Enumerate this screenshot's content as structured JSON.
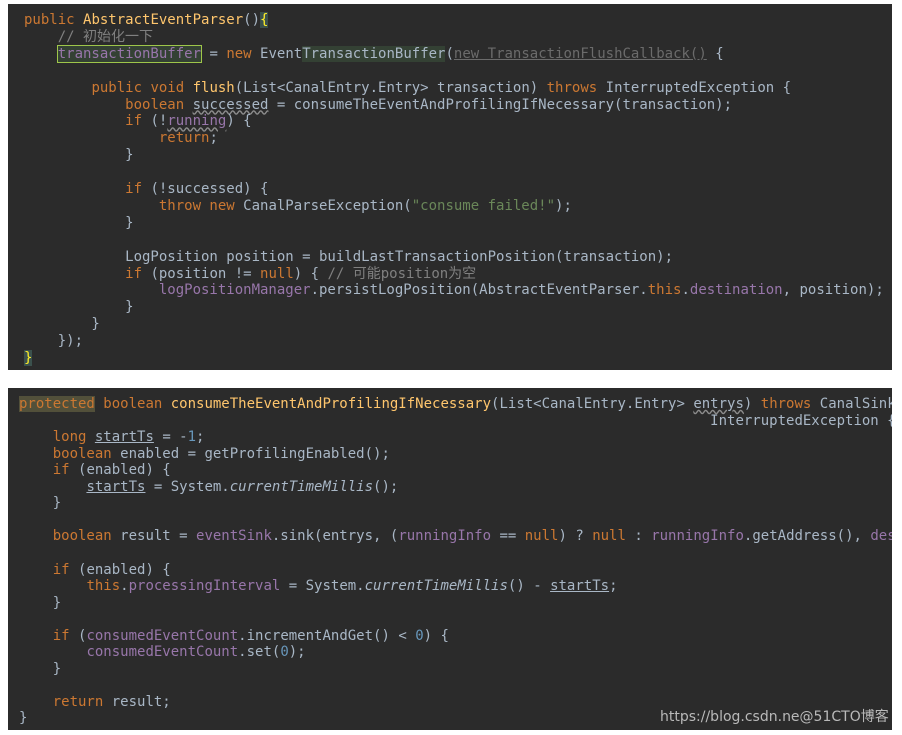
{
  "snippet1": {
    "lines": [
      [
        {
          "t": "public ",
          "c": "kw"
        },
        {
          "t": "AbstractEventParser",
          "c": "fn"
        },
        {
          "t": "()"
        },
        {
          "t": "{",
          "c": "brace-hl"
        }
      ],
      [
        {
          "t": "    "
        },
        {
          "t": "// 初始化一下",
          "c": "cm"
        }
      ],
      [
        {
          "t": "    "
        },
        {
          "t": "transactionBuffer",
          "c": "hl-box"
        },
        {
          "t": " = "
        },
        {
          "t": "new ",
          "c": "kw"
        },
        {
          "t": "Event"
        },
        {
          "t": "TransactionBuffer",
          "c": "hl-green"
        },
        {
          "t": "("
        },
        {
          "t": "new TransactionFlushCallback()",
          "c": "strike-dim"
        },
        {
          "t": " {"
        }
      ],
      [],
      [
        {
          "t": "        "
        },
        {
          "t": "public void ",
          "c": "kw"
        },
        {
          "t": "flush",
          "c": "fn"
        },
        {
          "t": "(List<CanalEntry.Entry> transaction) "
        },
        {
          "t": "throws ",
          "c": "kw"
        },
        {
          "t": "InterruptedException {"
        }
      ],
      [
        {
          "t": "            "
        },
        {
          "t": "boolean ",
          "c": "kw"
        },
        {
          "t": "successed",
          "c": "wavy"
        },
        {
          "t": " = consumeTheEventAndProfilingIfNecessary(transaction);"
        }
      ],
      [
        {
          "t": "            "
        },
        {
          "t": "if ",
          "c": "kw"
        },
        {
          "t": "(!"
        },
        {
          "t": "running",
          "c": "fld wavy"
        },
        {
          "t": ") {"
        }
      ],
      [
        {
          "t": "                "
        },
        {
          "t": "return",
          "c": "kw"
        },
        {
          "t": ";"
        }
      ],
      [
        {
          "t": "            }"
        }
      ],
      [],
      [
        {
          "t": "            "
        },
        {
          "t": "if ",
          "c": "kw"
        },
        {
          "t": "(!successed) {"
        }
      ],
      [
        {
          "t": "                "
        },
        {
          "t": "throw new ",
          "c": "kw"
        },
        {
          "t": "CanalParseException("
        },
        {
          "t": "\"consume failed!\"",
          "c": "str"
        },
        {
          "t": ");"
        }
      ],
      [
        {
          "t": "            }"
        }
      ],
      [],
      [
        {
          "t": "            LogPosition position = buildLastTransactionPosition(transaction);"
        }
      ],
      [
        {
          "t": "            "
        },
        {
          "t": "if ",
          "c": "kw"
        },
        {
          "t": "(position != "
        },
        {
          "t": "null",
          "c": "kw"
        },
        {
          "t": ") { "
        },
        {
          "t": "// 可能position为空",
          "c": "cm"
        }
      ],
      [
        {
          "t": "                "
        },
        {
          "t": "logPositionManager",
          "c": "fld"
        },
        {
          "t": ".persistLogPosition(AbstractEventParser."
        },
        {
          "t": "this",
          "c": "kw"
        },
        {
          "t": "."
        },
        {
          "t": "destination",
          "c": "fld"
        },
        {
          "t": ", position);"
        }
      ],
      [
        {
          "t": "            }"
        }
      ],
      [
        {
          "t": "        }"
        }
      ],
      [
        {
          "t": "    });"
        }
      ],
      [
        {
          "t": "}",
          "c": "brace-hl"
        }
      ]
    ]
  },
  "snippet2": {
    "lines": [
      [
        {
          "t": "protected",
          "c": "prot-hl"
        },
        {
          "t": " "
        },
        {
          "t": "boolean ",
          "c": "kw"
        },
        {
          "t": "consumeTheEventAndProfilingIfNecessary",
          "c": "fn"
        },
        {
          "t": "(List<CanalEntry.Entry> "
        },
        {
          "t": "entrys",
          "c": "wavy"
        },
        {
          "t": ") "
        },
        {
          "t": "throws ",
          "c": "kw"
        },
        {
          "t": "CanalSinkException,"
        }
      ],
      [
        {
          "t": "                                                                                  InterruptedException {"
        }
      ],
      [
        {
          "t": "    "
        },
        {
          "t": "long ",
          "c": "kw"
        },
        {
          "t": "startTs",
          "c": "und"
        },
        {
          "t": " = -"
        },
        {
          "t": "1",
          "c": "num"
        },
        {
          "t": ";"
        }
      ],
      [
        {
          "t": "    "
        },
        {
          "t": "boolean ",
          "c": "kw"
        },
        {
          "t": "enabled = getProfilingEnabled();"
        }
      ],
      [
        {
          "t": "    "
        },
        {
          "t": "if ",
          "c": "kw"
        },
        {
          "t": "(enabled) {"
        }
      ],
      [
        {
          "t": "        "
        },
        {
          "t": "startTs",
          "c": "und"
        },
        {
          "t": " = System."
        },
        {
          "t": "currentTimeMillis",
          "c": "it"
        },
        {
          "t": "();"
        }
      ],
      [
        {
          "t": "    }"
        }
      ],
      [],
      [
        {
          "t": "    "
        },
        {
          "t": "boolean ",
          "c": "kw"
        },
        {
          "t": "result = "
        },
        {
          "t": "eventSink",
          "c": "fld"
        },
        {
          "t": ".sink(entrys, ("
        },
        {
          "t": "runningInfo",
          "c": "fld"
        },
        {
          "t": " == "
        },
        {
          "t": "null",
          "c": "kw"
        },
        {
          "t": ") ? "
        },
        {
          "t": "null ",
          "c": "kw"
        },
        {
          "t": ": "
        },
        {
          "t": "runningInfo",
          "c": "fld"
        },
        {
          "t": ".getAddress(), "
        },
        {
          "t": "destination",
          "c": "fld"
        },
        {
          "t": ");"
        }
      ],
      [],
      [
        {
          "t": "    "
        },
        {
          "t": "if ",
          "c": "kw"
        },
        {
          "t": "(enabled) {"
        }
      ],
      [
        {
          "t": "        "
        },
        {
          "t": "this",
          "c": "kw"
        },
        {
          "t": "."
        },
        {
          "t": "processingInterval",
          "c": "fld"
        },
        {
          "t": " = System."
        },
        {
          "t": "currentTimeMillis",
          "c": "it"
        },
        {
          "t": "() - "
        },
        {
          "t": "startTs",
          "c": "und"
        },
        {
          "t": ";"
        }
      ],
      [
        {
          "t": "    }"
        }
      ],
      [],
      [
        {
          "t": "    "
        },
        {
          "t": "if ",
          "c": "kw"
        },
        {
          "t": "("
        },
        {
          "t": "consumedEventCount",
          "c": "fld"
        },
        {
          "t": ".incrementAndGet() < "
        },
        {
          "t": "0",
          "c": "num"
        },
        {
          "t": ") {"
        }
      ],
      [
        {
          "t": "        "
        },
        {
          "t": "consumedEventCount",
          "c": "fld"
        },
        {
          "t": ".set("
        },
        {
          "t": "0",
          "c": "num"
        },
        {
          "t": ");"
        }
      ],
      [
        {
          "t": "    }"
        }
      ],
      [],
      [
        {
          "t": "    "
        },
        {
          "t": "return ",
          "c": "kw"
        },
        {
          "t": "result;"
        }
      ],
      [
        {
          "t": "}"
        }
      ]
    ]
  },
  "watermark": "https://blog.csdn.ne@51CTO博客"
}
